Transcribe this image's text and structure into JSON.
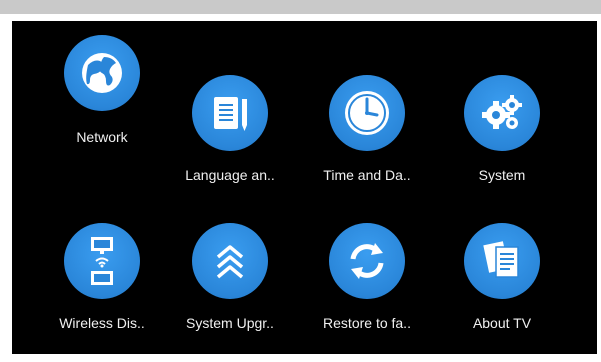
{
  "screen": {
    "row1": [
      {
        "id": "network",
        "label": "Network",
        "icon": "globe-icon"
      },
      {
        "id": "language",
        "label": "Language an..",
        "icon": "notebook-pen-icon"
      },
      {
        "id": "time",
        "label": "Time and Da..",
        "icon": "clock-icon"
      },
      {
        "id": "system",
        "label": "System",
        "icon": "gears-icon"
      }
    ],
    "row2": [
      {
        "id": "wireless",
        "label": "Wireless Dis..",
        "icon": "screen-cast-icon"
      },
      {
        "id": "upgrade",
        "label": "System Upgr..",
        "icon": "chevrons-up-icon"
      },
      {
        "id": "restore",
        "label": "Restore to fa..",
        "icon": "refresh-icon"
      },
      {
        "id": "about",
        "label": "About TV",
        "icon": "documents-icon"
      }
    ]
  },
  "colors": {
    "accent": "#2a86d9",
    "background": "#000000",
    "label": "#f0f0f0"
  }
}
